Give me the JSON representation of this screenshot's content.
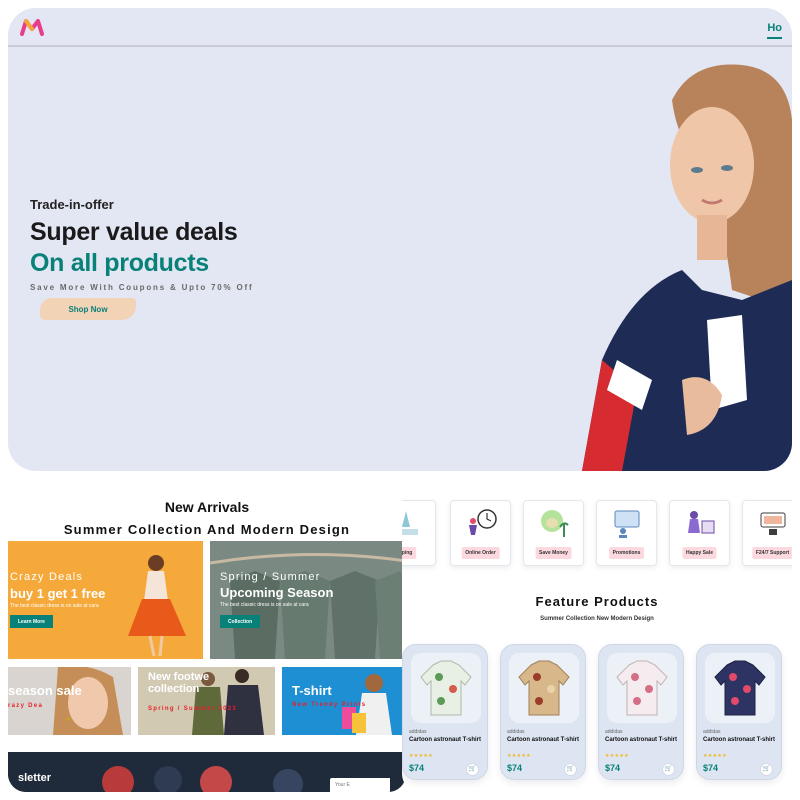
{
  "hero": {
    "nav_home": "Ho",
    "kicker": "Trade-in-offer",
    "headline": "Super value deals",
    "headline_accent": "On all products",
    "subline": "Save More With Coupons & Upto 70% Off",
    "cta": "Shop Now"
  },
  "arrivals": {
    "title": "New Arrivals",
    "subtitle": "Summer Collection And Modern Design",
    "banners": [
      {
        "small": "Crazy Deals",
        "big": "buy 1 get 1 free",
        "tiny": "The best classic dress is on sale at cara",
        "button": "Learn More"
      },
      {
        "small": "Spring / Summer",
        "big": "Upcoming Season",
        "tiny": "The best classic dress is on sale at cara",
        "button": "Collection"
      },
      {
        "big": "season sale",
        "red": "razy Dea"
      },
      {
        "big": "New footwe collection",
        "red": "Spring / Summer 2023"
      },
      {
        "big": "T-shirt",
        "red": "New Trendy Prints"
      }
    ],
    "newsletter_title": "sletter",
    "newsletter_placeholder": "Your E"
  },
  "features": {
    "items": [
      {
        "label": "pping",
        "icon": "free-shipping-icon"
      },
      {
        "label": "Online Order",
        "icon": "online-order-icon"
      },
      {
        "label": "Save Money",
        "icon": "save-money-icon"
      },
      {
        "label": "Promotions",
        "icon": "promotions-icon"
      },
      {
        "label": "Happy Sale",
        "icon": "happy-sale-icon"
      },
      {
        "label": "F24/7 Support",
        "icon": "support-icon"
      }
    ],
    "title": "Feature Products",
    "subtitle": "Summer Collection New Modern Design"
  },
  "products": [
    {
      "brand": "addidas",
      "name": "Cartoon astronaut T-shirt",
      "stars": "★★★★★",
      "price": "$74",
      "color": "#e8efe4",
      "print": "#5e9a57"
    },
    {
      "brand": "addidas",
      "name": "Cartoon astronaut T-shirt",
      "stars": "★★★★★",
      "price": "$74",
      "color": "#d8b78a",
      "print": "#9b3b2a"
    },
    {
      "brand": "addidas",
      "name": "Cartoon astronaut T-shirt",
      "stars": "★★★★★",
      "price": "$74",
      "color": "#f4ecee",
      "print": "#d56f86"
    },
    {
      "brand": "addidas",
      "name": "Cartoon astronaut T-shirt",
      "stars": "★★★★★",
      "price": "$74",
      "color": "#2d3464",
      "print": "#e14a6a"
    }
  ],
  "colors": {
    "accent": "#088178",
    "hero_bg": "#e3e6f3",
    "label_pink": "#fcd9df",
    "star": "#f3b519",
    "sale_red": "#e8202a"
  }
}
